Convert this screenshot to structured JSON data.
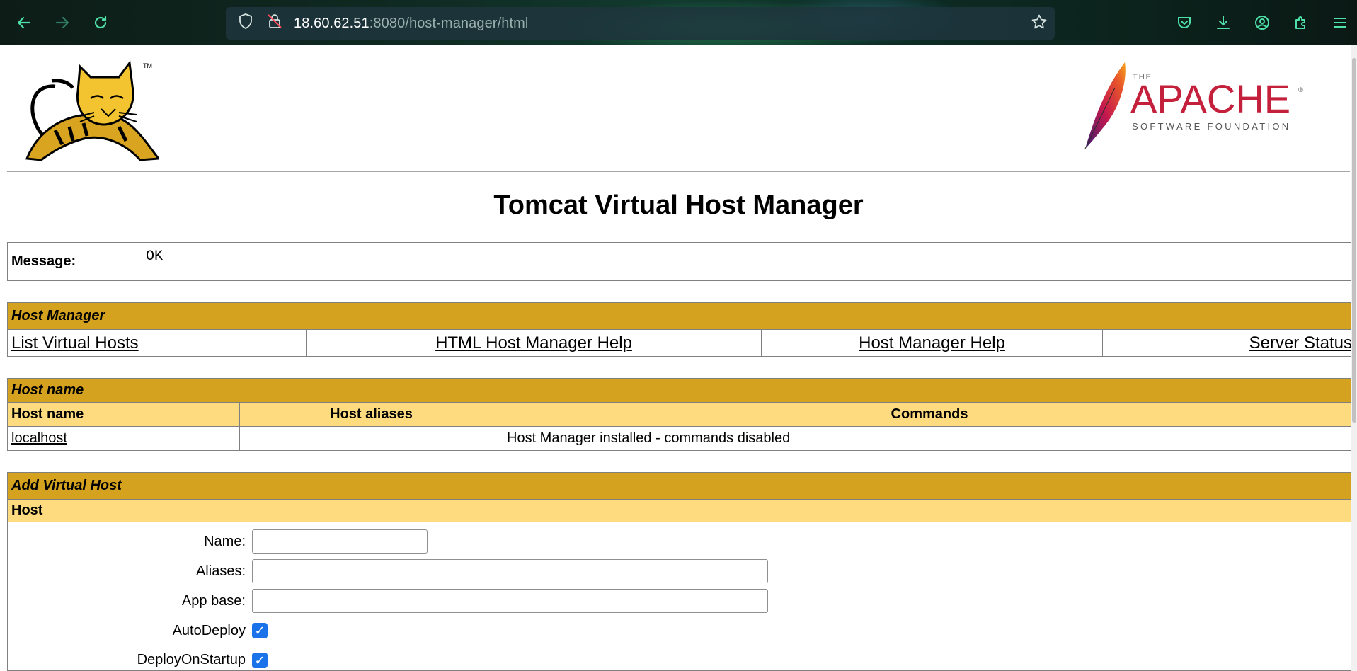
{
  "browser": {
    "url_host": "18.60.62.51",
    "url_rest": ":8080/host-manager/html"
  },
  "page": {
    "title": "Tomcat Virtual Host Manager",
    "tomcat_tm": "TM",
    "apache_logo": {
      "the": "THE",
      "name": "APACHE",
      "sub": "SOFTWARE FOUNDATION",
      "reg": "®"
    }
  },
  "message": {
    "label": "Message:",
    "value": "OK"
  },
  "host_manager": {
    "heading": "Host Manager",
    "links": [
      {
        "label": "List Virtual Hosts"
      },
      {
        "label": "HTML Host Manager Help"
      },
      {
        "label": "Host Manager Help"
      },
      {
        "label": "Server Status"
      }
    ]
  },
  "hosts": {
    "heading": "Host name",
    "columns": [
      "Host name",
      "Host aliases",
      "Commands"
    ],
    "rows": [
      {
        "name": "localhost",
        "aliases": "",
        "commands": "Host Manager installed - commands disabled"
      }
    ]
  },
  "add_host": {
    "heading": "Add Virtual Host",
    "subheading": "Host",
    "fields": {
      "name_label": "Name:",
      "name_value": "",
      "aliases_label": "Aliases:",
      "aliases_value": "",
      "appbase_label": "App base:",
      "appbase_value": "",
      "autodeploy_label": "AutoDeploy",
      "autodeploy_checked": true,
      "deployonstartup_label": "DeployOnStartup",
      "deployonstartup_checked": true
    }
  },
  "colors": {
    "section_header": "#d4a21e",
    "sub_header": "#ffdb7f",
    "chrome_accent": "#4ee0a8",
    "checkbox": "#1a73e8"
  }
}
